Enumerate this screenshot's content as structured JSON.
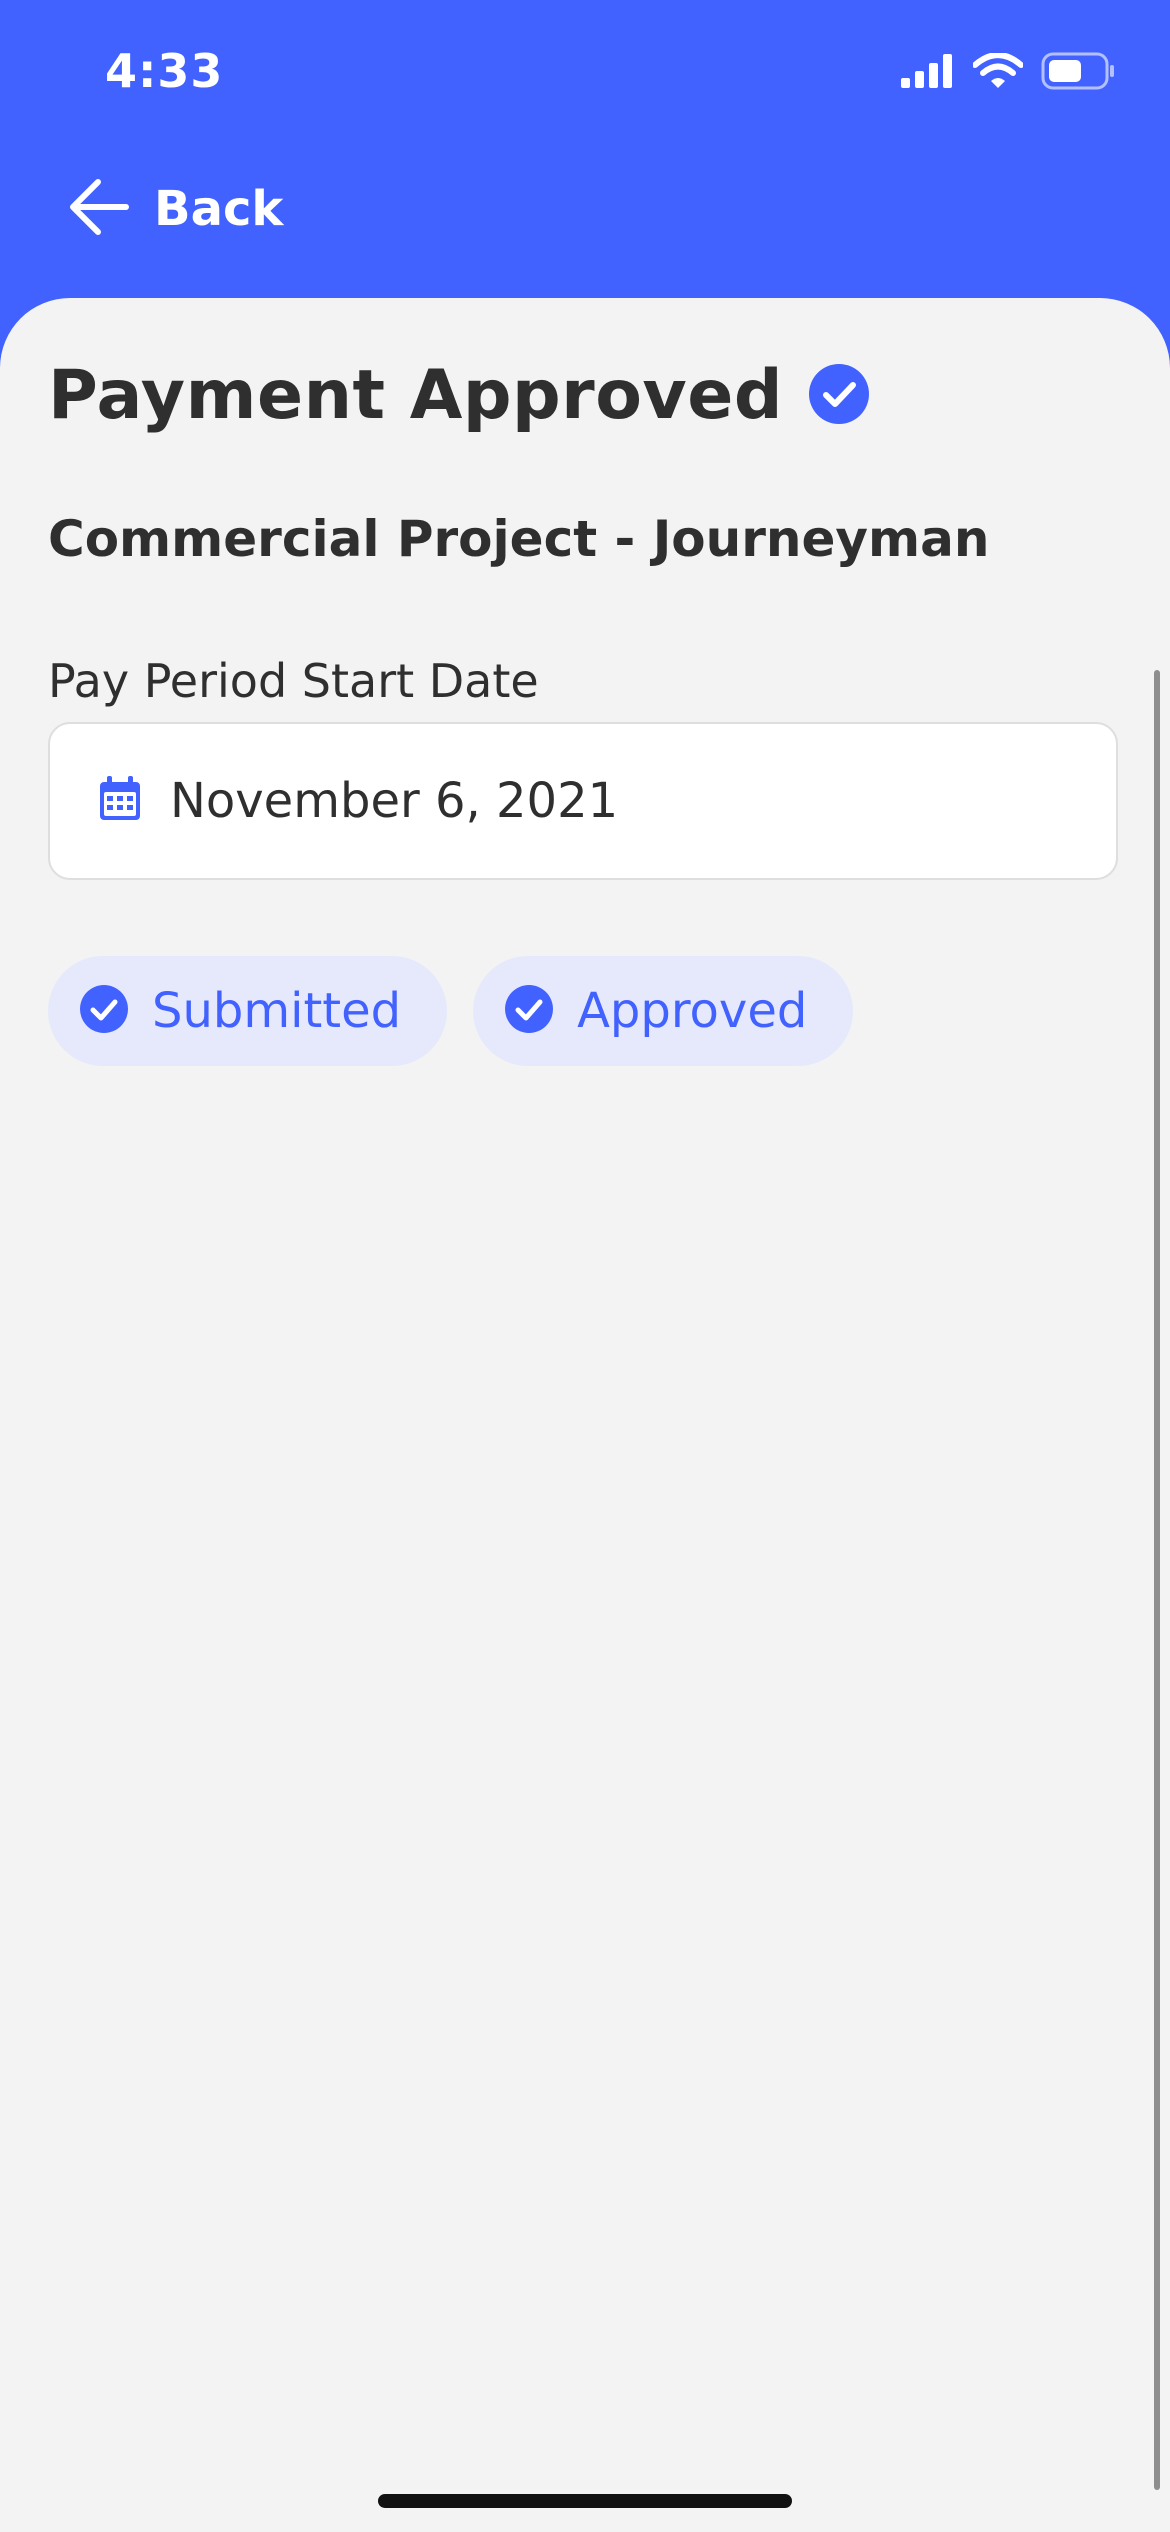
{
  "status_bar": {
    "time": "4:33",
    "icons": [
      "signal-icon",
      "wifi-icon",
      "battery-icon"
    ]
  },
  "nav": {
    "back_label": "Back",
    "back_icon": "arrow-left-icon"
  },
  "page": {
    "title": "Payment Approved",
    "title_icon": "check-circle-icon",
    "project_title": "Commercial Project - Journeyman"
  },
  "date_field": {
    "label": "Pay Period Start Date",
    "value": "November 6, 2021",
    "icon": "calendar-icon"
  },
  "status_chips": [
    {
      "label": "Submitted",
      "icon": "check-circle-icon"
    },
    {
      "label": "Approved",
      "icon": "check-circle-icon"
    }
  ],
  "colors": {
    "brand": "#4262FF",
    "background": "#F3F3F3",
    "chip_background": "#E5E9FB",
    "text": "#2F2F2F"
  }
}
